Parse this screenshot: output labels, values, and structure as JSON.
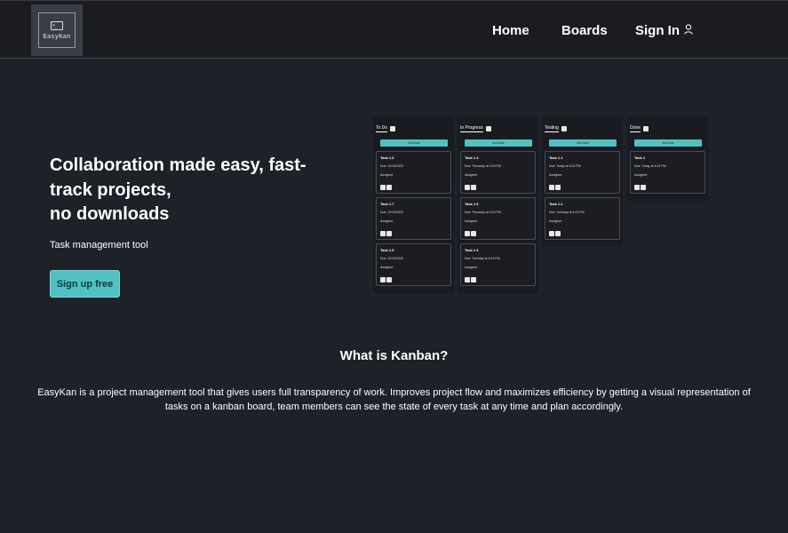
{
  "brand": {
    "logo_text": "EasyKan",
    "terminal_glyph": ">_"
  },
  "nav": {
    "home": "Home",
    "boards": "Boards",
    "sign_in": "Sign In"
  },
  "hero": {
    "title_line1": "Collaboration made easy, fast-",
    "title_line2": "track projects,",
    "title_line3": "no downloads",
    "subtitle": "Task management tool",
    "cta": "Sign up free"
  },
  "board_preview": {
    "add_task_label": "Add task",
    "assignee_label": "Assignee",
    "columns": [
      {
        "name": "To Do",
        "cards": [
          {
            "title": "Task 1.6",
            "due": "Due: 12/13/2022"
          },
          {
            "title": "Task 1.7",
            "due": "Due: 12/13/2022"
          },
          {
            "title": "Task 1.8",
            "due": "Due: 12/13/2022"
          }
        ]
      },
      {
        "name": "In Progress",
        "cards": [
          {
            "title": "Task 1.4",
            "due": "Due: Thursday at 4:23 PM"
          },
          {
            "title": "Task 1.5",
            "due": "Due: Thursday at 4:23 PM"
          },
          {
            "title": "Task 1.3",
            "due": "Due: Tuesday at 4:23 PM"
          }
        ]
      },
      {
        "name": "Testing",
        "cards": [
          {
            "title": "Task 1.1",
            "due": "Due: Today at 4:23 PM"
          },
          {
            "title": "Task 1.2",
            "due": "Due: Tuesday at 4:23 PM"
          }
        ]
      },
      {
        "name": "Done",
        "cards": [
          {
            "title": "Task 1",
            "due": "Due: Today at 4:23 PM"
          }
        ]
      }
    ]
  },
  "about": {
    "title": "What is Kanban?",
    "body": "EasyKan is a project management tool that gives users full transparency of work. Improves project flow and maximizes efficiency by getting a visual representation of tasks on a kanban board, team members can see the state of every task at any time and plan accordingly."
  },
  "colors": {
    "background": "#1f2129",
    "navbar": "#1b1c21",
    "accent": "#52c1c3"
  }
}
